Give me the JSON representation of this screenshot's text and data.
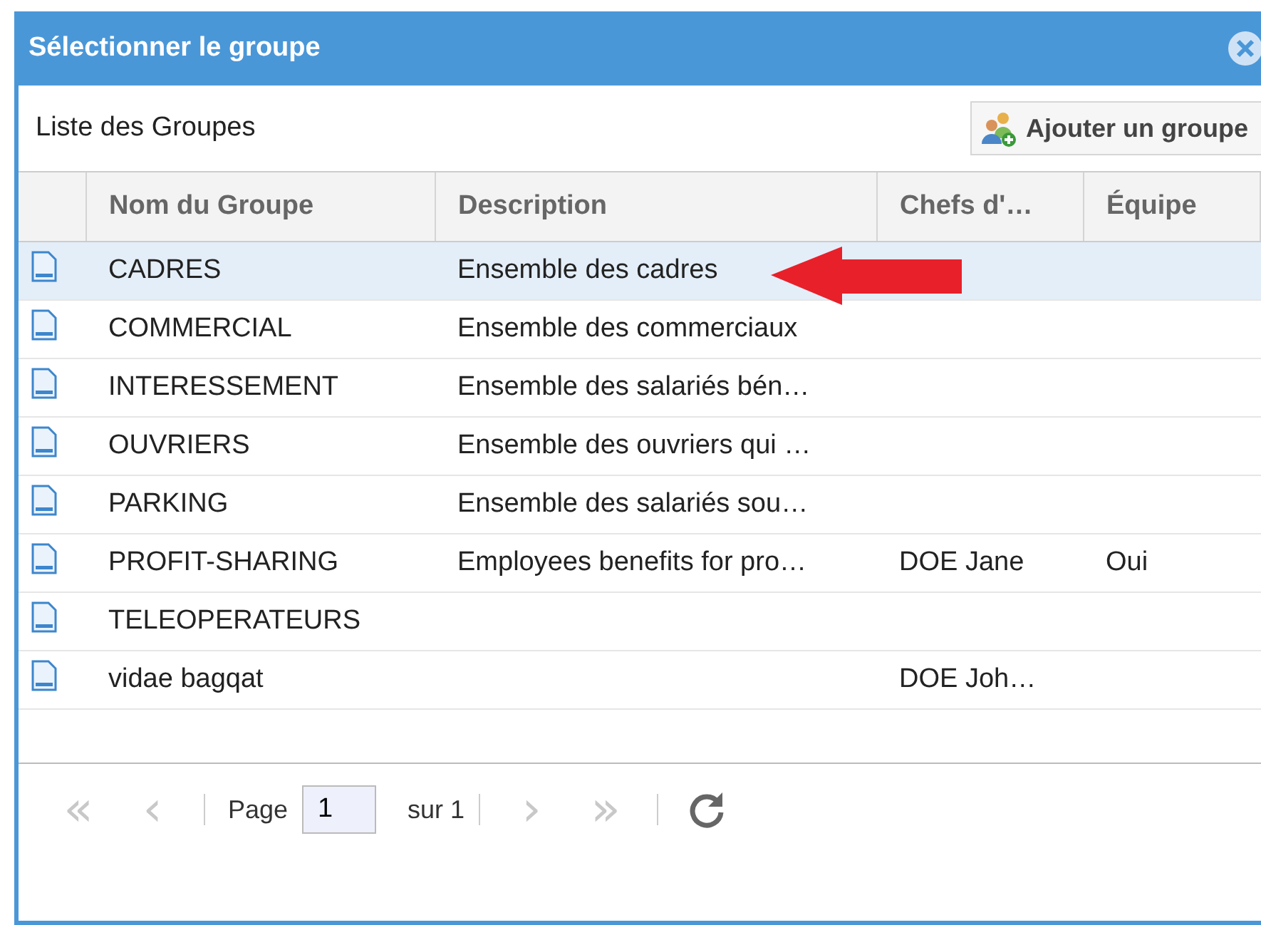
{
  "window": {
    "title": "Sélectionner le groupe"
  },
  "toolbar": {
    "title": "Liste des Groupes",
    "add_button": "Ajouter un groupe"
  },
  "table": {
    "columns": [
      "Nom du Groupe",
      "Description",
      "Chefs d'…",
      "Équipe"
    ],
    "rows": [
      {
        "name": "CADRES",
        "description": "Ensemble des cadres",
        "chefs": "",
        "equipe": "",
        "selected": true
      },
      {
        "name": "COMMERCIAL",
        "description": "Ensemble des commerciaux",
        "chefs": "",
        "equipe": "",
        "selected": false
      },
      {
        "name": "INTERESSEMENT",
        "description": "Ensemble des salariés bén…",
        "chefs": "",
        "equipe": "",
        "selected": false
      },
      {
        "name": "OUVRIERS",
        "description": "Ensemble des ouvriers qui …",
        "chefs": "",
        "equipe": "",
        "selected": false
      },
      {
        "name": "PARKING",
        "description": "Ensemble des salariés sou…",
        "chefs": "",
        "equipe": "",
        "selected": false
      },
      {
        "name": "PROFIT-SHARING",
        "description": "Employees benefits for pro…",
        "chefs": "DOE Jane",
        "equipe": "Oui",
        "selected": false
      },
      {
        "name": "TELEOPERATEURS",
        "description": "",
        "chefs": "",
        "equipe": "",
        "selected": false
      },
      {
        "name": "vidae bagqat",
        "description": "",
        "chefs": "DOE Joh…",
        "equipe": "",
        "selected": false
      }
    ]
  },
  "pager": {
    "first": {
      "label": "«",
      "disabled": true
    },
    "prev": {
      "label": "‹",
      "disabled": true
    },
    "page_label": "Page",
    "page": "1",
    "of": "sur 1",
    "next": {
      "label": "›",
      "disabled": true
    },
    "last": {
      "label": "»",
      "disabled": true
    }
  }
}
